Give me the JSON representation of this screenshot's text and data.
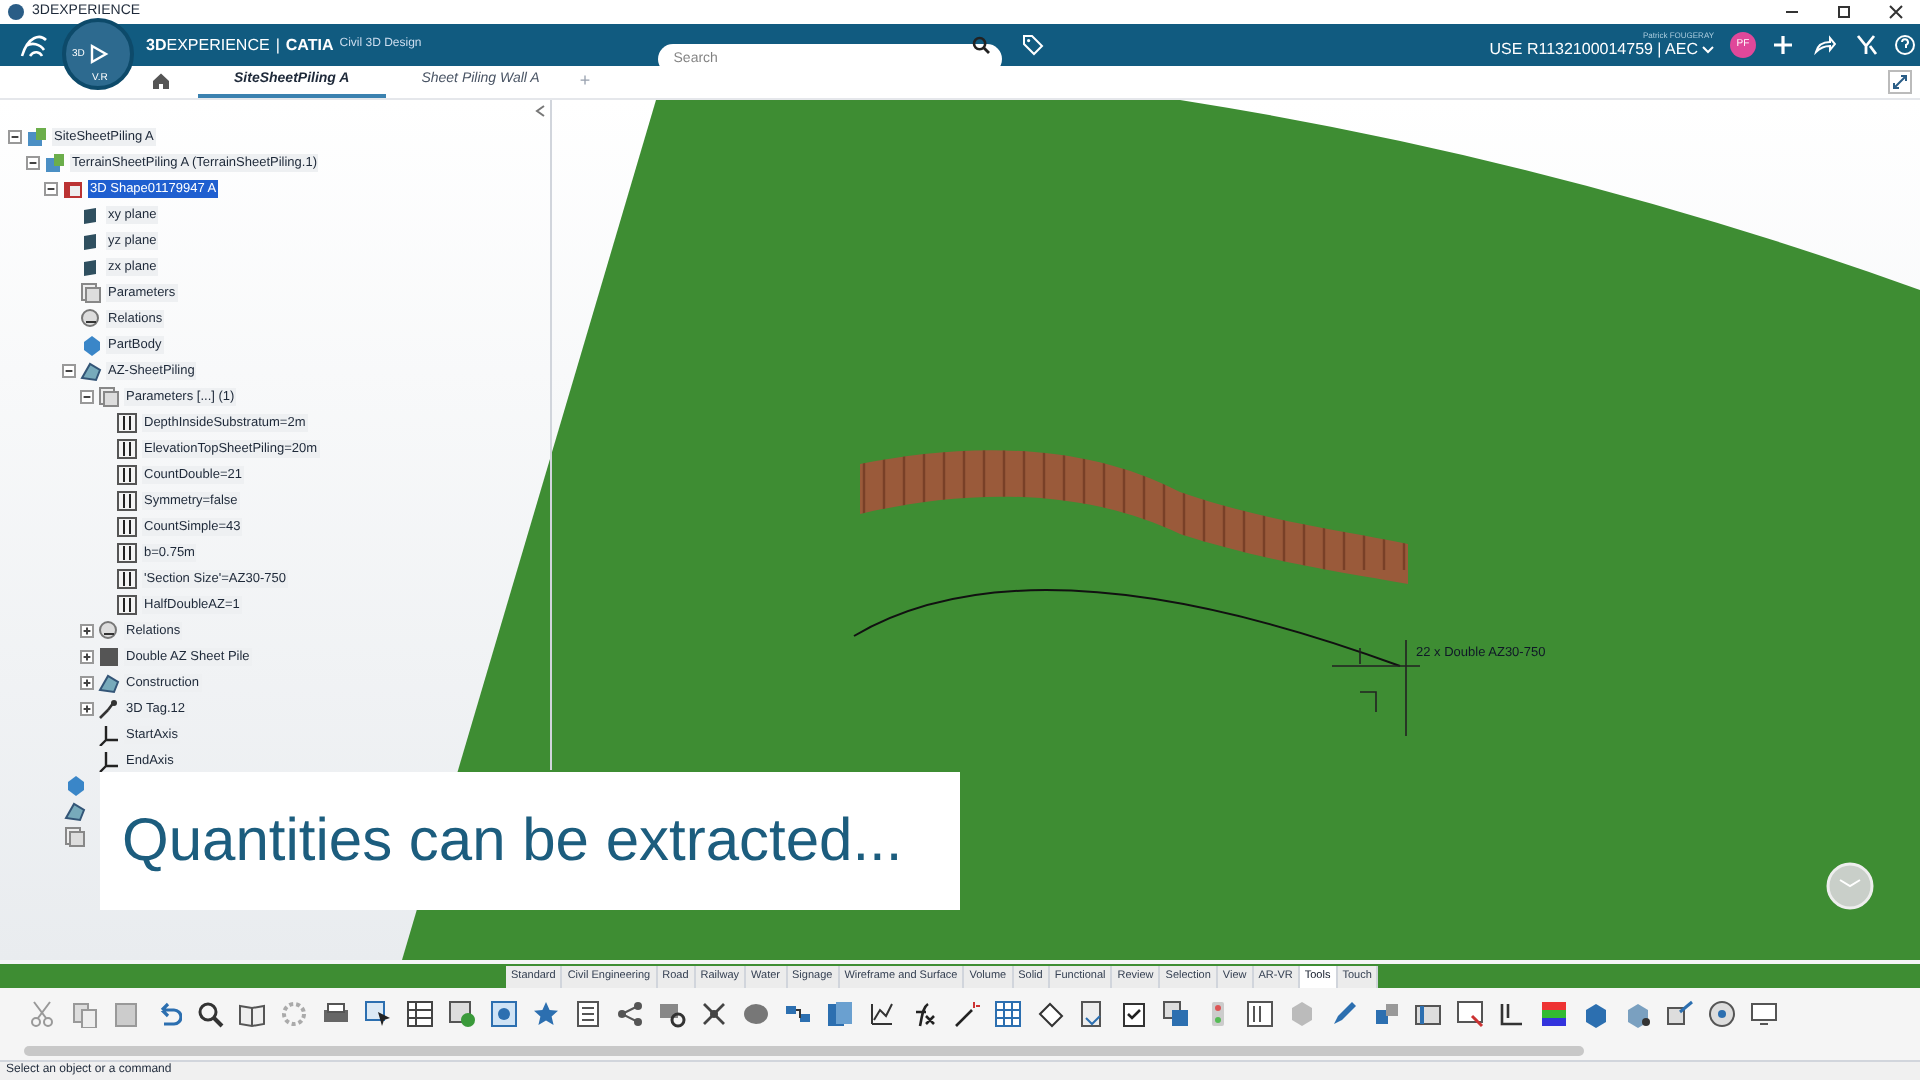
{
  "window": {
    "title": "3DEXPERIENCE"
  },
  "header": {
    "brand": "**3D**EXPERIENCE",
    "separator": "|",
    "app": "CATIA",
    "role": "Civil 3D Design",
    "compass_labels": [
      "3D",
      "V.R"
    ],
    "search": {
      "placeholder": "Search"
    },
    "user": {
      "name": "Patrick FOUGERAY",
      "context": "USE R1132100014759 | AEC",
      "initials": "PF"
    }
  },
  "tabs": [
    {
      "label": "SiteSheetPiling A",
      "selected": true
    },
    {
      "label": "Sheet Piling Wall A",
      "selected": false
    }
  ],
  "add_tab": "+",
  "tree": [
    {
      "label": "SiteSheetPiling A",
      "kind": "product",
      "expanded": true,
      "selected": false,
      "children": [
        {
          "label": "TerrainSheetPiling A (TerrainSheetPiling.1)",
          "kind": "product",
          "expanded": true,
          "selected": false,
          "children": [
            {
              "label": "3D Shape01179947 A",
              "kind": "shape",
              "expanded": true,
              "selected": true,
              "children": [
                {
                  "label": "xy plane",
                  "kind": "plane",
                  "selected": false
                },
                {
                  "label": "yz plane",
                  "kind": "plane",
                  "selected": false
                },
                {
                  "label": "zx plane",
                  "kind": "plane",
                  "selected": false
                },
                {
                  "label": "Parameters",
                  "kind": "parameters",
                  "selected": false
                },
                {
                  "label": "Relations",
                  "kind": "relations",
                  "selected": false
                },
                {
                  "label": "PartBody",
                  "kind": "body",
                  "selected": false
                },
                {
                  "label": "AZ-SheetPiling",
                  "kind": "set",
                  "expanded": true,
                  "selected": false,
                  "children": [
                    {
                      "label": "Parameters [...] (1)",
                      "kind": "parameters",
                      "expanded": true,
                      "selected": false,
                      "children": [
                        {
                          "label": "DepthInsideSubstratum=2m",
                          "kind": "parameter",
                          "selected": false
                        },
                        {
                          "label": "ElevationTopSheetPiling=20m",
                          "kind": "parameter",
                          "selected": false
                        },
                        {
                          "label": "CountDouble=21",
                          "kind": "parameter",
                          "selected": false
                        },
                        {
                          "label": "Symmetry=false",
                          "kind": "parameter",
                          "selected": false
                        },
                        {
                          "label": "CountSimple=43",
                          "kind": "parameter",
                          "selected": false
                        },
                        {
                          "label": "b=0.75m",
                          "kind": "parameter",
                          "selected": false
                        },
                        {
                          "label": "'Section Size'=AZ30-750",
                          "kind": "parameter",
                          "selected": false
                        },
                        {
                          "label": "HalfDoubleAZ=1",
                          "kind": "parameter",
                          "selected": false
                        }
                      ]
                    },
                    {
                      "label": "Relations",
                      "kind": "relations",
                      "expanded": false,
                      "selected": false
                    },
                    {
                      "label": "Double AZ Sheet Pile",
                      "kind": "solid",
                      "expanded": false,
                      "selected": false
                    },
                    {
                      "label": "Construction",
                      "kind": "set",
                      "expanded": false,
                      "selected": false
                    },
                    {
                      "label": "3D Tag.12",
                      "kind": "tag",
                      "expanded": false,
                      "selected": false
                    },
                    {
                      "label": "StartAxis",
                      "kind": "axis",
                      "selected": false
                    },
                    {
                      "label": "EndAxis",
                      "kind": "axis",
                      "selected": false
                    }
                  ]
                }
              ]
            }
          ]
        }
      ]
    }
  ],
  "annotation": "22 x Double AZ30-750",
  "caption": "Quantities can be extracted...",
  "toolbar_tabs": [
    {
      "label": "Standard",
      "selected": false
    },
    {
      "label": "Civil Engineering",
      "selected": false
    },
    {
      "label": "Road",
      "selected": false
    },
    {
      "label": "Railway",
      "selected": false
    },
    {
      "label": "Water",
      "selected": false
    },
    {
      "label": "Signage",
      "selected": false
    },
    {
      "label": "Wireframe and Surface",
      "selected": false
    },
    {
      "label": "Volume",
      "selected": false
    },
    {
      "label": "Solid",
      "selected": false
    },
    {
      "label": "Functional",
      "selected": false
    },
    {
      "label": "Review",
      "selected": false
    },
    {
      "label": "Selection",
      "selected": false
    },
    {
      "label": "View",
      "selected": false
    },
    {
      "label": "AR-VR",
      "selected": false
    },
    {
      "label": "Tools",
      "selected": true
    },
    {
      "label": "Touch",
      "selected": false
    }
  ],
  "status_bar": "Select an object or a command"
}
